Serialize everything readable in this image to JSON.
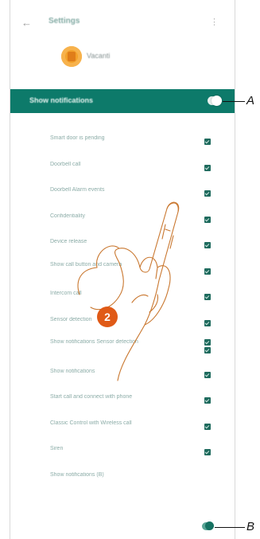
{
  "header": {
    "title": "Settings",
    "back_icon": "arrow-left-icon",
    "menu_icon": "dots-icon"
  },
  "user": {
    "name": "Vacanti",
    "avatar_icon": "user-avatar-icon",
    "avatar_color": "#f3a12a"
  },
  "notifications": {
    "label": "Show notifications",
    "enabled": true,
    "accent": "#0d7a6a"
  },
  "rows": [
    {
      "label": "Smart door is pending"
    },
    {
      "label": "Doorbell call"
    },
    {
      "label": "Doorbell Alarm events"
    },
    {
      "label": "Confidentiality"
    },
    {
      "label": "Device release"
    },
    {
      "label": "Show call button and camera"
    },
    {
      "label": "Intercom call"
    },
    {
      "label": "Sensor detection"
    },
    {
      "label": "Show notifications Sensor detection"
    },
    {
      "label": "Show notifications"
    },
    {
      "label": "Start call and connect with phone"
    },
    {
      "label": "Classic Control with Wireless call"
    },
    {
      "label": "Siren"
    },
    {
      "label": "Show notifications (B)"
    }
  ],
  "callouts": {
    "a": "A",
    "b": "B"
  },
  "step": "2"
}
